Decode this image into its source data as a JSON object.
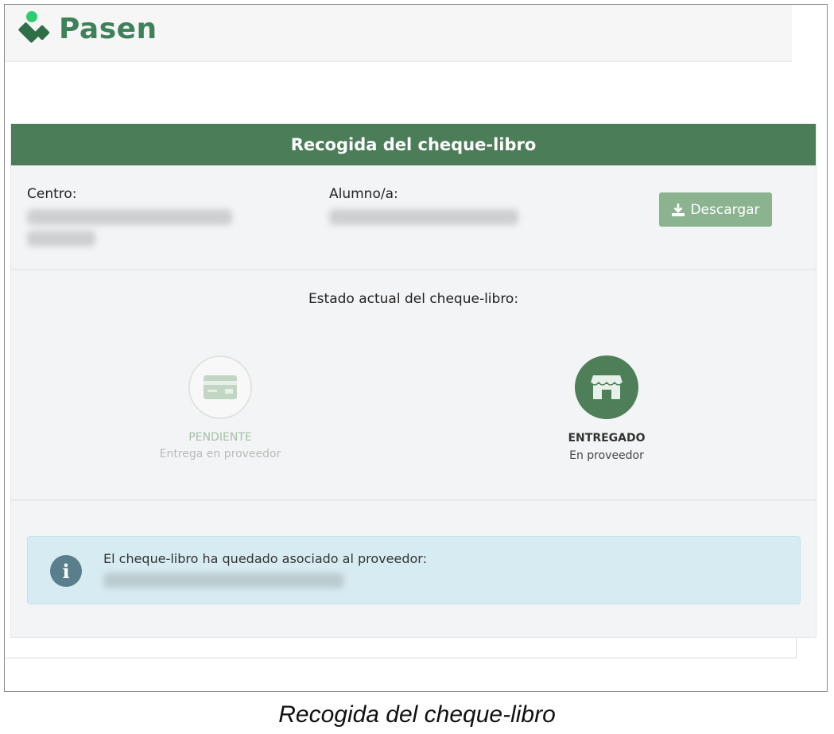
{
  "app": {
    "brand": "Pasen",
    "brand_color": "#3f8159",
    "logo_accent_color": "#2ecc71"
  },
  "panel": {
    "header_title": "Recogida del cheque-libro",
    "header_color": "#4b7d58",
    "centro_label": "Centro:",
    "alumno_label": "Alumno/a:",
    "download_label": "Descargar",
    "download_icon": "download-icon",
    "status_title": "Estado actual del cheque-libro:",
    "statuses": [
      {
        "label": "PENDIENTE",
        "sub": "Entrega en proveedor",
        "icon": "card-icon",
        "active": false
      },
      {
        "label": "ENTREGADO",
        "sub": "En proveedor",
        "icon": "store-icon",
        "active": true
      }
    ],
    "alert": {
      "icon": "info-icon",
      "icon_text": "i",
      "message": "El cheque-libro ha quedado asociado al proveedor:"
    }
  },
  "caption": "Recogida del cheque-libro"
}
